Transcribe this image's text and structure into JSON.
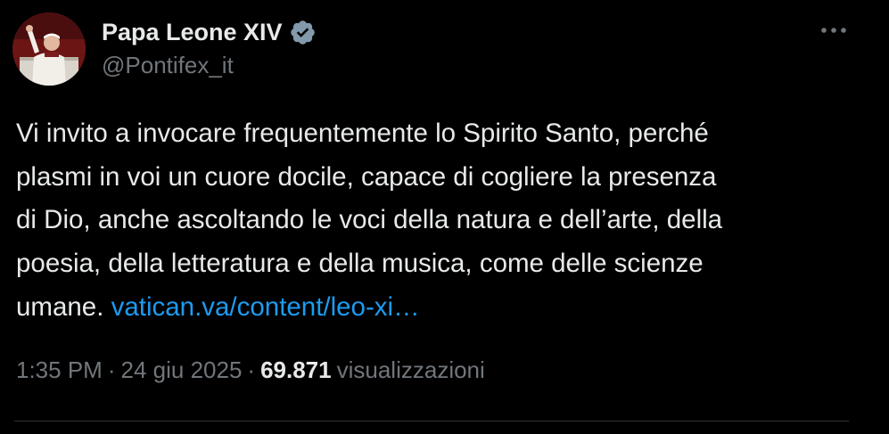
{
  "tweet": {
    "author": {
      "display_name": "Papa Leone XIV",
      "handle": "@Pontifex_it",
      "verified": true,
      "verified_color": "#829aab",
      "avatar_icon": "avatar-photo"
    },
    "more_icon": "more-dots-icon",
    "text_lines": [
      "Vi invito a invocare frequentemente lo Spirito Santo, perché",
      "plasmi in voi un cuore docile, capace di cogliere la presenza",
      "di Dio, anche ascoltando le voci della natura e dell’arte, della",
      "poesia, della letteratura e della musica, come delle scienze",
      "umane."
    ],
    "link_text": "vatican.va/content/leo-xi…",
    "meta": {
      "time": "1:35 PM",
      "separator": "·",
      "date": "24 giu 2025",
      "views_count": "69.871",
      "views_label": "visualizzazioni"
    }
  },
  "colors": {
    "background": "#000000",
    "text": "#e7e9ea",
    "secondary": "#71767b",
    "link": "#1d9bf0",
    "divider": "#2f3336"
  }
}
